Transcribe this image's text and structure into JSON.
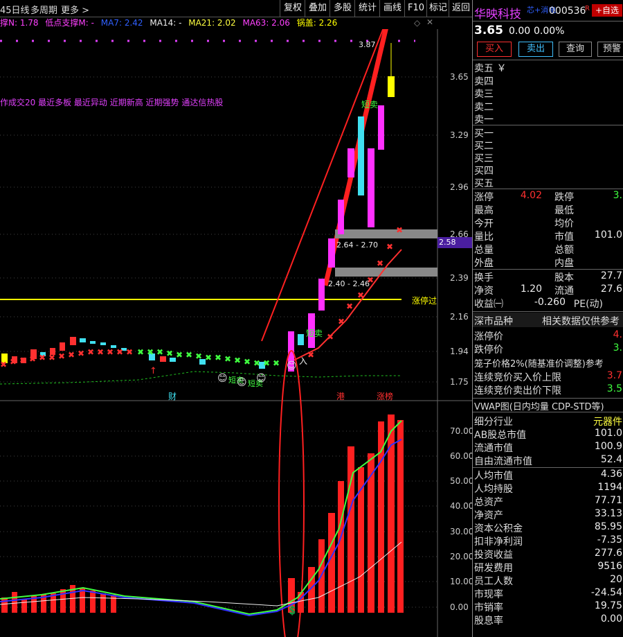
{
  "toolbar": {
    "period_label": "45日线",
    "multi_period": "多周期",
    "more": "更多 >",
    "buttons": [
      "复权",
      "叠加",
      "多股",
      "统计",
      "画线",
      "F10",
      "标记",
      "返回"
    ]
  },
  "indicators": {
    "support_n": "撑N: 1.78",
    "low_support": "低点支撑M: -",
    "ma7": "MA7: 2.42",
    "ma14": "MA14: -",
    "ma21": "MA21: 2.02",
    "ma63": "MA63: 2.06",
    "pot_lid": "锅盖: 2.26"
  },
  "tags_line": "作成交20 最近多板 最近异动 近期新高 近期强势 通达信热股",
  "price_axis": [
    "3.65",
    "3.29",
    "2.96",
    "2.66",
    "2.39",
    "2.16",
    "1.94",
    "1.75"
  ],
  "volume_axis": [
    "70.00",
    "60.00",
    "50.00",
    "40.00",
    "30.00",
    "20.00",
    "10.00",
    "0.00"
  ],
  "chart_labels": {
    "high_mark": "3.87",
    "box1": "2.64 - 2.70",
    "box2": "2.40 - 2.46",
    "price_tag": "2.58",
    "limit_line": "涨停过",
    "short_sell1": "短卖",
    "short_sell2": "短卖",
    "short_sell3": "短卖",
    "short_sell4": "短卖",
    "enter_mark": "入",
    "bottom_marks": [
      "财",
      "港",
      "涨榜"
    ]
  },
  "stock": {
    "name": "华映科技",
    "concept": "芯+消电",
    "code": "000536",
    "r_badge": "R",
    "watch_button": "+自选",
    "price": "3.65",
    "change": "0.00",
    "change_pct": "0.00%",
    "buy_button": "买入",
    "sell_button": "卖出",
    "query_button": "查询",
    "alert_button": "预警"
  },
  "orderbook": {
    "asks": [
      "卖五 ￥",
      "卖四",
      "卖三",
      "卖二",
      "卖一"
    ],
    "bids": [
      "买一",
      "买二",
      "买三",
      "买四",
      "买五"
    ]
  },
  "quote": {
    "limit_up_label": "涨停",
    "limit_up": "4.02",
    "limit_down_label": "跌停",
    "limit_down": "3.",
    "high_label": "最高",
    "low_label": "最低",
    "open_label": "今开",
    "avg_label": "均价",
    "vol_ratio_label": "量比",
    "mktcap_label": "市值",
    "mktcap": "101.0",
    "total_vol_label": "总量",
    "total_amt_label": "总额",
    "outer_label": "外盘",
    "inner_label": "内盘",
    "turnover_label": "换手",
    "capital_label": "股本",
    "capital": "27.7",
    "nav_label": "净资",
    "nav": "1.20",
    "float_label": "流通",
    "float": "27.6",
    "eps_label": "收益㈠",
    "eps": "-0.260",
    "pe_label": "PE(动)"
  },
  "market": {
    "title": "深市品种",
    "note": "相关数据仅供参考",
    "limit_up_price_label": "涨停价",
    "limit_up_price": "4.",
    "limit_down_price_label": "跌停价",
    "limit_down_price": "3.",
    "cage_label": "笼子价格2%(随基准价调整)参考",
    "auction_up_label": "连续竞价买入价上限",
    "auction_up": "3.7",
    "auction_down_label": "连续竞价卖出价下限",
    "auction_down": "3.5"
  },
  "fundamentals": {
    "vwap_title": "VWAP图(日内均量 CDP-STD等)",
    "items": [
      {
        "label": "细分行业",
        "value": "元器件"
      },
      {
        "label": "AB股总市值",
        "value": "101.0"
      },
      {
        "label": "流通市值",
        "value": "100.9"
      },
      {
        "label": "自由流通市值",
        "value": "52.4"
      },
      {
        "label": "人均市值",
        "value": "4.36"
      },
      {
        "label": "人均持股",
        "value": "1194"
      },
      {
        "label": "总资产",
        "value": "77.71"
      },
      {
        "label": "净资产",
        "value": "33.13"
      },
      {
        "label": "资本公积金",
        "value": "85.95"
      },
      {
        "label": "扣非净利润",
        "value": "-7.35"
      },
      {
        "label": "投资收益",
        "value": "277.6"
      },
      {
        "label": "研发费用",
        "value": "9516"
      },
      {
        "label": "员工人数",
        "value": "20"
      },
      {
        "label": "市现率",
        "value": "-24.54"
      },
      {
        "label": "市销率",
        "value": "19.75"
      },
      {
        "label": "股息率",
        "value": "0.00"
      }
    ]
  },
  "colors": {
    "up": "#ff3030",
    "down": "#40e0f0",
    "ma7": "#3030ff",
    "ma21": "#ff40ff",
    "ma63": "#40ff40",
    "yellow": "#ffff00",
    "magenta": "#e040fb"
  }
}
